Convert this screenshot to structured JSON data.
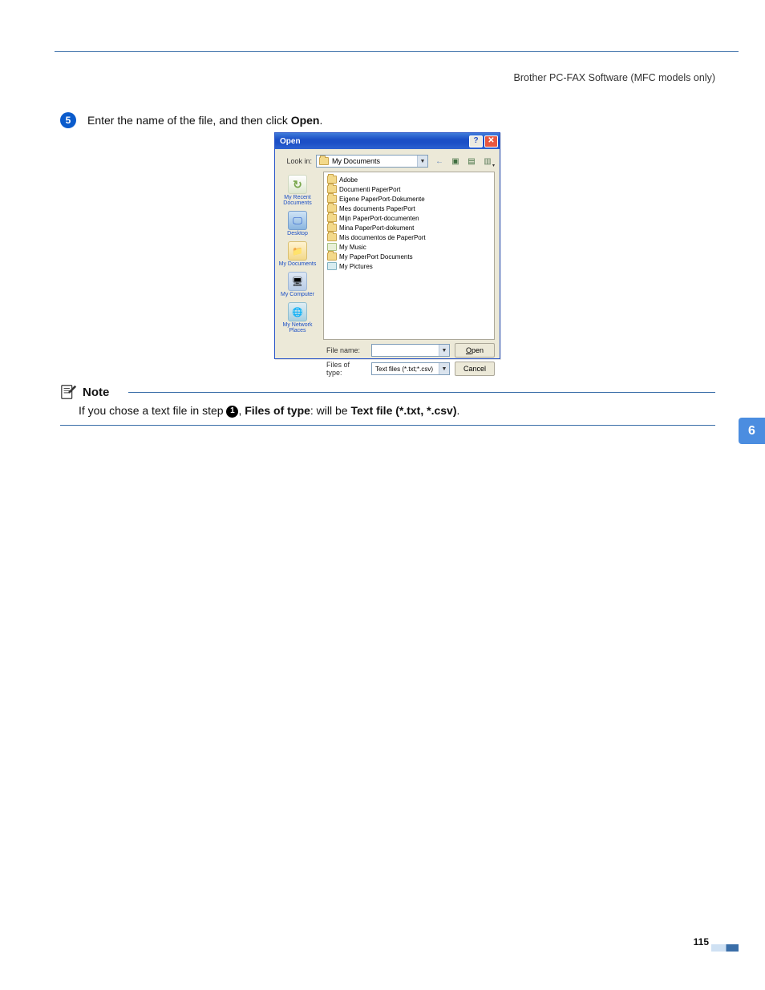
{
  "header": {
    "breadcrumb": "Brother PC-FAX Software (MFC models only)"
  },
  "step": {
    "number": "5",
    "prefix": "Enter the name of the file, and then click ",
    "bold": "Open",
    "suffix": "."
  },
  "dialog": {
    "title": "Open",
    "help_btn": "?",
    "close_btn": "✕",
    "look_in_label": "Look in:",
    "look_in_value": "My Documents",
    "nav": {
      "back": "←",
      "up": "▣",
      "new": "▤",
      "views": "▥"
    },
    "places": [
      {
        "label": "My Recent Documents"
      },
      {
        "label": "Desktop"
      },
      {
        "label": "My Documents"
      },
      {
        "label": "My Computer"
      },
      {
        "label": "My Network Places"
      }
    ],
    "files": [
      {
        "icon": "folder",
        "name": "Adobe"
      },
      {
        "icon": "folder",
        "name": "Documenti PaperPort"
      },
      {
        "icon": "folder",
        "name": "Eigene PaperPort-Dokumente"
      },
      {
        "icon": "folder",
        "name": "Mes documents PaperPort"
      },
      {
        "icon": "folder",
        "name": "Mijn PaperPort-documenten"
      },
      {
        "icon": "folder",
        "name": "Mina PaperPort-dokument"
      },
      {
        "icon": "folder",
        "name": "Mis documentos de PaperPort"
      },
      {
        "icon": "music",
        "name": "My Music"
      },
      {
        "icon": "folder",
        "name": "My PaperPort Documents"
      },
      {
        "icon": "pics",
        "name": "My Pictures"
      }
    ],
    "filename_label": "File name:",
    "filename_value": "",
    "filetype_label": "Files of type:",
    "filetype_value": "Text files (*.txt;*.csv)",
    "open_btn_u": "O",
    "open_btn_rest": "pen",
    "cancel_btn": "Cancel"
  },
  "note": {
    "title": "Note",
    "body_prefix": "If you chose a text file in step ",
    "step_ref": "1",
    "body_mid": ", ",
    "bold1": "Files of type",
    "body_mid2": ": will be ",
    "bold2": "Text file (*.txt, *.csv)",
    "body_suffix": "."
  },
  "sidebar": {
    "chapter": "6"
  },
  "footer": {
    "page": "115"
  }
}
